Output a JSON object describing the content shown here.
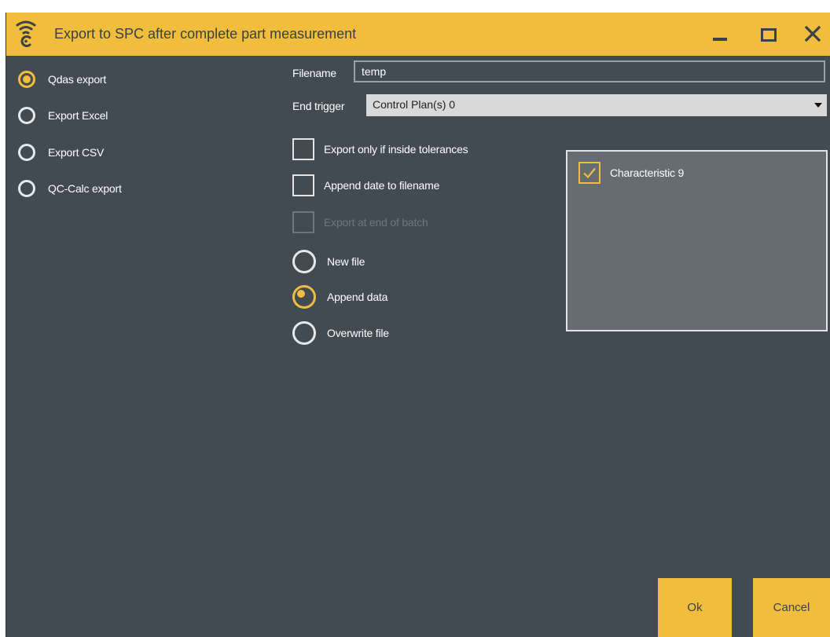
{
  "window": {
    "title": "Export to SPC after complete part measurement",
    "app_icon": "wifi-signal-icon",
    "accent_color": "#f0bd3c",
    "background_color": "#424b52"
  },
  "export_types": [
    {
      "label": "Qdas export",
      "selected": true
    },
    {
      "label": "Export Excel",
      "selected": false
    },
    {
      "label": "Export CSV",
      "selected": false
    },
    {
      "label": "QC-Calc export",
      "selected": false
    }
  ],
  "form": {
    "filename_label": "Filename",
    "filename_value": "temp",
    "end_trigger_label": "End trigger",
    "end_trigger_value": "Control Plan(s) 0"
  },
  "options": [
    {
      "label": "Export only if inside tolerances",
      "checked": false,
      "enabled": true
    },
    {
      "label": "Append date to filename",
      "checked": false,
      "enabled": true
    },
    {
      "label": "Export at end of batch",
      "checked": false,
      "enabled": false
    }
  ],
  "file_modes": [
    {
      "label": "New file",
      "selected": false
    },
    {
      "label": "Append data",
      "selected": true
    },
    {
      "label": "Overwrite file",
      "selected": false
    }
  ],
  "characteristics": [
    {
      "label": "Characteristic 9",
      "checked": true
    }
  ],
  "buttons": {
    "ok_label": "Ok",
    "cancel_label": "Cancel"
  }
}
